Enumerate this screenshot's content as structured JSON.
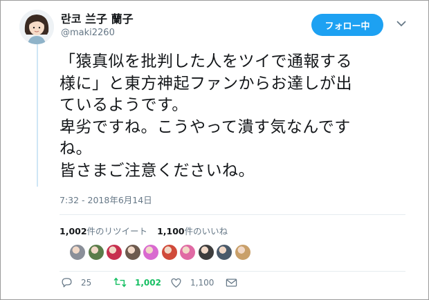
{
  "user": {
    "display_name": "란코 兰子 蘭子",
    "handle": "@maki2260"
  },
  "follow_button": {
    "label": "フォロー中"
  },
  "tweet": {
    "text": "「猿真似を批判した人をツイで通報する\n様に」と東方神起ファンからお達しが出\nているようです。\n卑劣ですね。こうやって潰す気なんです\nね。\n皆さまご注意くださいね。",
    "timestamp": "7:32 - 2018年6月14日"
  },
  "stats": {
    "retweet_count": "1,002",
    "retweet_label": "件のリツイート",
    "like_count": "1,100",
    "like_label": "件のいいね"
  },
  "liker_avatars": [
    {
      "icon": "liker-avatar-icon",
      "color": "#8a8f99"
    },
    {
      "icon": "liker-avatar-icon",
      "color": "#5a7d4a"
    },
    {
      "icon": "liker-avatar-icon",
      "color": "#c7304f"
    },
    {
      "icon": "liker-avatar-icon",
      "color": "#6d5a4e"
    },
    {
      "icon": "liker-avatar-icon",
      "color": "#d96ad0"
    },
    {
      "icon": "liker-avatar-icon",
      "color": "#d04a3a"
    },
    {
      "icon": "liker-avatar-icon",
      "color": "#e06aa4"
    },
    {
      "icon": "liker-avatar-icon",
      "color": "#3d3d3d"
    },
    {
      "icon": "liker-avatar-icon",
      "color": "#4a5a6a"
    },
    {
      "icon": "liker-avatar-icon",
      "color": "#c9a06a"
    }
  ],
  "actions": {
    "reply_count": "25",
    "retweet_count": "1,002",
    "like_count": "1,100"
  },
  "colors": {
    "accent": "#1da1f2",
    "retweeted_green": "#17bf63",
    "muted": "#657786"
  }
}
